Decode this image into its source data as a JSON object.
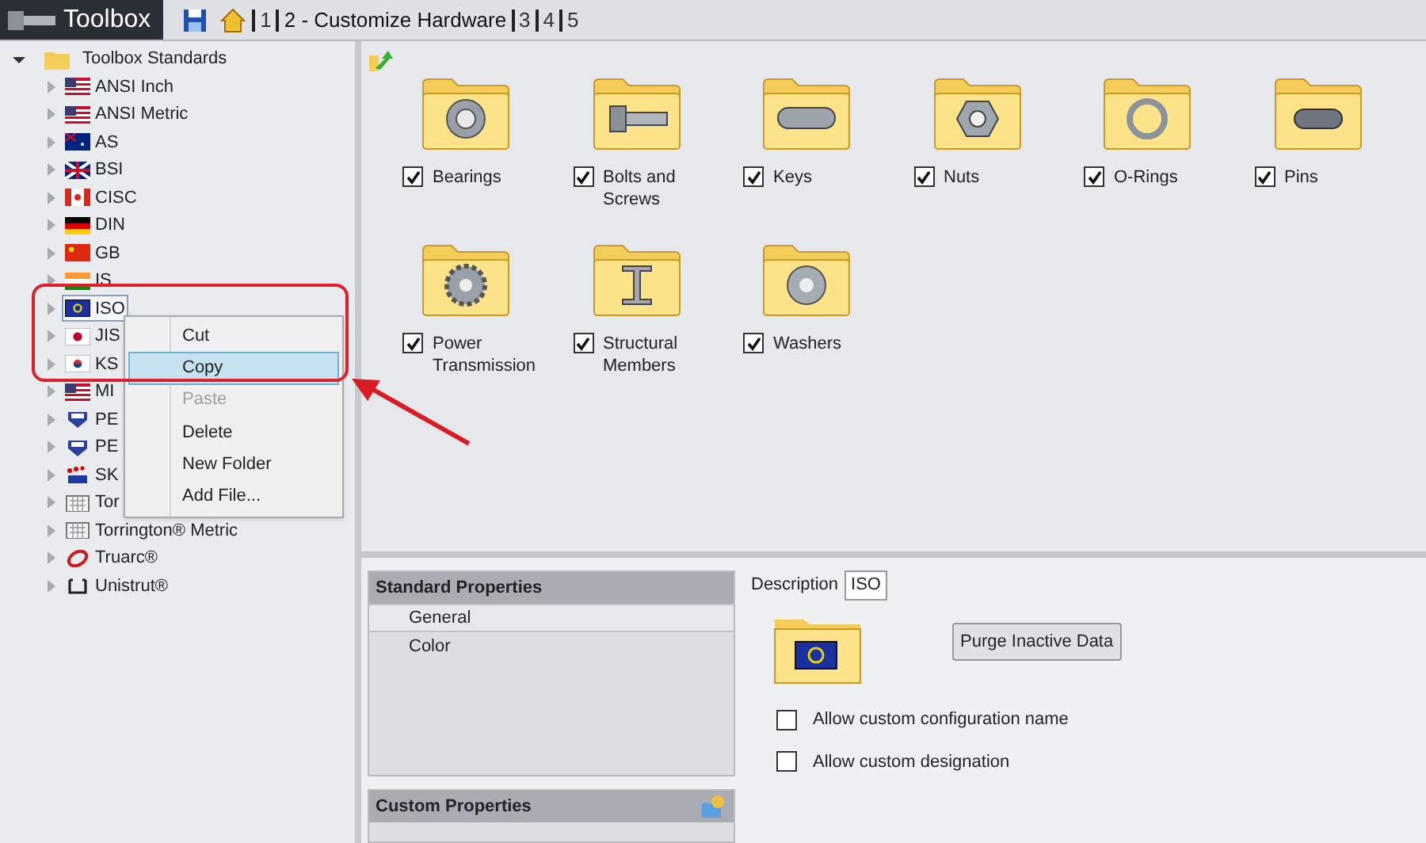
{
  "toolbar": {
    "title": "Toolbox",
    "breadcrumbs": [
      {
        "label": "1",
        "selected": false
      },
      {
        "label": "2 - Customize Hardware",
        "selected": true
      },
      {
        "label": "3",
        "selected": false
      },
      {
        "label": "4",
        "selected": false
      },
      {
        "label": "5",
        "selected": false
      }
    ]
  },
  "tree": {
    "label": "Toolbox Standards",
    "expanded": true,
    "children": [
      {
        "label": "ANSI Inch",
        "kind": "us",
        "selected": false
      },
      {
        "label": "ANSI Metric",
        "kind": "us",
        "selected": false
      },
      {
        "label": "AS",
        "kind": "au",
        "selected": false
      },
      {
        "label": "BSI",
        "kind": "uk",
        "selected": false
      },
      {
        "label": "CISC",
        "kind": "ca",
        "selected": false
      },
      {
        "label": "DIN",
        "kind": "de",
        "selected": false
      },
      {
        "label": "GB",
        "kind": "cn",
        "selected": false
      },
      {
        "label": "IS",
        "kind": "in",
        "selected": false
      },
      {
        "label": "ISO",
        "kind": "iso",
        "selected": true
      },
      {
        "label": "JIS",
        "kind": "jp",
        "selected": false
      },
      {
        "label": "KS",
        "kind": "kr",
        "selected": false
      },
      {
        "label": "MI",
        "kind": "us",
        "selected": false
      },
      {
        "label": "PE",
        "kind": "pem",
        "selected": false
      },
      {
        "label": "PE",
        "kind": "pem",
        "selected": false
      },
      {
        "label": "SK",
        "kind": "skf",
        "selected": false
      },
      {
        "label": "Tor",
        "kind": "bearing",
        "selected": false
      },
      {
        "label": "Torrington® Metric",
        "kind": "bearing",
        "selected": false
      },
      {
        "label": "Truarc®",
        "kind": "ring",
        "selected": false
      },
      {
        "label": "Unistrut®",
        "kind": "channel",
        "selected": false
      }
    ]
  },
  "context_menu": [
    {
      "label": "Cut",
      "selected": false,
      "disabled": false
    },
    {
      "label": "Copy",
      "selected": true,
      "disabled": false
    },
    {
      "label": "Paste",
      "selected": false,
      "disabled": true
    },
    {
      "label": "Delete",
      "selected": false,
      "disabled": false
    },
    {
      "label": "New Folder",
      "selected": false,
      "disabled": false
    },
    {
      "label": "Add File...",
      "selected": false,
      "disabled": false
    }
  ],
  "categories": [
    {
      "label": "Bearings",
      "kind": "bearing",
      "checked": true
    },
    {
      "label": "Bolts and Screws",
      "kind": "bolt",
      "checked": true
    },
    {
      "label": "Keys",
      "kind": "key",
      "checked": true
    },
    {
      "label": "Nuts",
      "kind": "nut",
      "checked": true
    },
    {
      "label": "O-Rings",
      "kind": "oring",
      "checked": true
    },
    {
      "label": "Pins",
      "kind": "pin",
      "checked": true
    },
    {
      "label": "Power Transmission",
      "kind": "gear",
      "checked": true
    },
    {
      "label": "Structural Members",
      "kind": "beam",
      "checked": true
    },
    {
      "label": "Washers",
      "kind": "washer",
      "checked": true
    }
  ],
  "standard_properties": {
    "title": "Standard Properties",
    "items": [
      {
        "label": "General",
        "selected": true
      },
      {
        "label": "Color",
        "selected": false
      }
    ]
  },
  "custom_properties": {
    "title": "Custom Properties"
  },
  "details": {
    "description_label": "Description",
    "description": "ISO",
    "purge_button": "Purge Inactive Data",
    "options": [
      {
        "label": "Allow custom configuration name",
        "checked": false
      },
      {
        "label": "Allow custom designation",
        "checked": false
      }
    ]
  }
}
